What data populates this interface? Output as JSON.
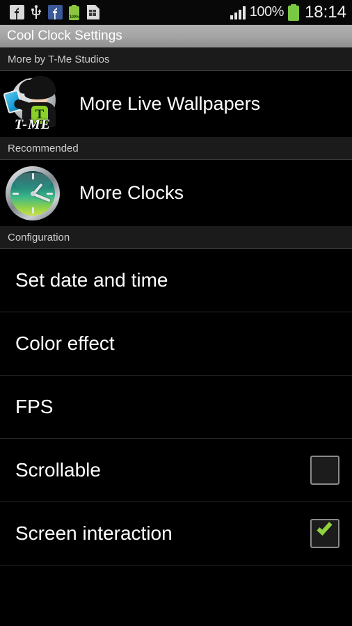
{
  "status_bar": {
    "icons": [
      {
        "name": "facebook-notification-white-icon",
        "glyph": "f"
      },
      {
        "name": "usb-icon",
        "glyph": "usb"
      },
      {
        "name": "facebook-blue-icon",
        "glyph": "f"
      },
      {
        "name": "battery-charge-icon",
        "glyph": "battery",
        "value": "100%"
      },
      {
        "name": "sim-card-alert-icon",
        "glyph": "sim"
      }
    ],
    "battery_small_label": "100%",
    "signal_bars": 4,
    "battery_percent": "100%",
    "time": "18:14",
    "battery_color": "#7ac943"
  },
  "title_bar": {
    "title": "Cool Clock Settings"
  },
  "sections": [
    {
      "header": "More by T-Me Studios",
      "type": "promo",
      "items": [
        {
          "label": "More Live Wallpapers",
          "icon": "t-me-studios-logo-icon",
          "logo_text": "T-ME",
          "logo_shirt_letter": "T"
        }
      ]
    },
    {
      "header": "Recommended",
      "type": "promo",
      "items": [
        {
          "label": "More Clocks",
          "icon": "analog-clock-icon"
        }
      ]
    },
    {
      "header": "Configuration",
      "type": "settings",
      "items": [
        {
          "label": "Set date and time",
          "control": "none"
        },
        {
          "label": "Color effect",
          "control": "none"
        },
        {
          "label": "FPS",
          "control": "none"
        },
        {
          "label": "Scrollable",
          "control": "checkbox",
          "checked": false
        },
        {
          "label": "Screen interaction",
          "control": "checkbox",
          "checked": true
        }
      ]
    }
  ],
  "colors": {
    "background": "#000000",
    "title_bar_gradient_top": "#b2b2b2",
    "title_bar_gradient_bottom": "#8f8f8f",
    "section_header_bg": "#1b1b1b",
    "section_header_text": "#cfcfcf",
    "row_text": "#ffffff",
    "divider": "#262626",
    "checkbox_border": "#8a8a8a",
    "checkmark_green": "#8fd13f",
    "accent_green": "#8bd028"
  }
}
